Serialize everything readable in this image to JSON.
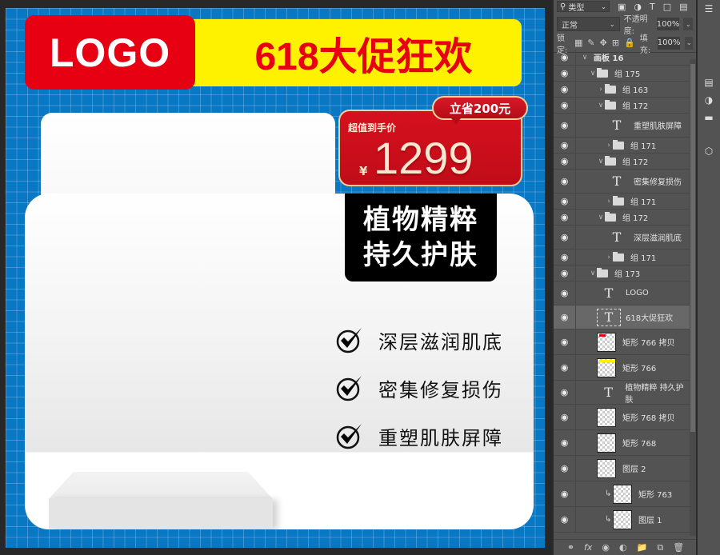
{
  "artboard": {
    "logo_text": "LOGO",
    "promo_title": "618大促狂欢",
    "price": {
      "save_badge": "立省200元",
      "label": "超值到手价",
      "currency": "¥",
      "value": "1299"
    },
    "slogan": [
      "植物精粹",
      "持久护肤"
    ],
    "features": [
      {
        "icon": "check-circle-icon",
        "text": "深层滋润肌底"
      },
      {
        "icon": "check-circle-icon",
        "text": "密集修复损伤"
      },
      {
        "icon": "check-circle-icon",
        "text": "重塑肌肤屏障"
      }
    ],
    "colors": {
      "background": "#0877c4",
      "logo_red": "#e60012",
      "promo_yellow": "#fff200",
      "price_gold": "#f3cf9a"
    }
  },
  "layers_panel": {
    "filter_kind": "类型",
    "blend_mode": "正常",
    "opacity_label": "不透明度:",
    "opacity_value": "100%",
    "lock_label": "锁定:",
    "fill_label": "填充:",
    "fill_value": "100%",
    "layers": [
      {
        "type": "artboard",
        "name": "画板 16",
        "expanded": true
      },
      {
        "type": "group",
        "name": "组 175",
        "expanded": true
      },
      {
        "type": "group",
        "name": "组 163",
        "expanded": false
      },
      {
        "type": "group",
        "name": "组 172",
        "expanded": true
      },
      {
        "type": "text",
        "name": "重塑肌肤屏障"
      },
      {
        "type": "group",
        "name": "组 171",
        "expanded": false
      },
      {
        "type": "group",
        "name": "组 172",
        "expanded": true
      },
      {
        "type": "text",
        "name": "密集修复损伤"
      },
      {
        "type": "group",
        "name": "组 171",
        "expanded": false
      },
      {
        "type": "group",
        "name": "组 172",
        "expanded": true
      },
      {
        "type": "text",
        "name": "深层滋润肌底"
      },
      {
        "type": "group",
        "name": "组 171",
        "expanded": false
      },
      {
        "type": "group",
        "name": "组 173",
        "expanded": true
      },
      {
        "type": "text",
        "name": "LOGO"
      },
      {
        "type": "text",
        "name": "618大促狂欢",
        "selected": true
      },
      {
        "type": "shape",
        "name": "矩形 766 拷贝",
        "thumb_color": "#e60012"
      },
      {
        "type": "shape",
        "name": "矩形 766",
        "thumb_color": "#fff200"
      },
      {
        "type": "text",
        "name": "植物精粹 持久护肤"
      },
      {
        "type": "shape",
        "name": "矩形 768 拷贝"
      },
      {
        "type": "shape",
        "name": "矩形 768"
      },
      {
        "type": "pixel",
        "name": "图层 2"
      },
      {
        "type": "shape",
        "name": "矩形 763",
        "clipped": true
      },
      {
        "type": "pixel",
        "name": "图层 1",
        "clipped": true
      }
    ],
    "footer_icons": [
      "link-icon",
      "fx-icon",
      "mask-icon",
      "adjustment-icon",
      "folder-icon",
      "new-layer-icon",
      "trash-icon"
    ]
  }
}
